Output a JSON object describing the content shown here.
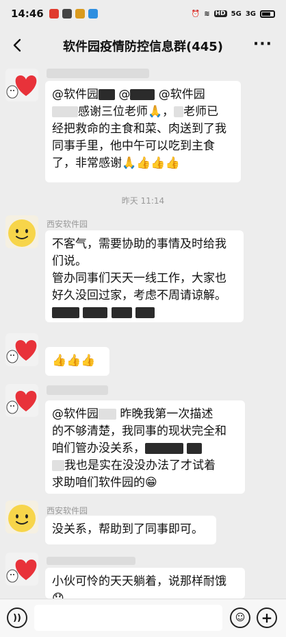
{
  "status_bar": {
    "time": "14:46",
    "network_labels": [
      "HD",
      "5G",
      "3G"
    ]
  },
  "header": {
    "title": "软件园疫情防控信息群(445)",
    "more": "···"
  },
  "messages": [
    {
      "sender": "",
      "avatar": "heart-cat",
      "lines": [
        "@软件园▮ @▮ @软件园▮",
        "▮感谢三位老师🙏，▮老师已",
        "经把救命的主食和菜、肉送到了我",
        "同事手里，他中午可以吃到主食",
        "了，非常感谢🙏👍👍👍"
      ]
    },
    {
      "sender": "西安软件园",
      "avatar": "smile",
      "lines": [
        "不客气，需要协助的事情及时给我",
        "们说。",
        "管办同事们天天一线工作，大家也",
        "好久没回过家，考虑不周请谅解。"
      ]
    },
    {
      "sender": "",
      "avatar": "heart-cat",
      "lines": [
        "👍👍👍"
      ]
    },
    {
      "sender": "",
      "avatar": "heart-cat",
      "lines": [
        "@软件园▮ 昨晚我第一次描述",
        "的不够清楚，我同事的现状完全和",
        "咱们管办没关系，▮",
        "▮我也是实在没没办法了才试着",
        "求助咱们软件园的😁"
      ]
    },
    {
      "sender": "西安软件园",
      "avatar": "smile",
      "lines": [
        "没关系，帮助到了同事即可。"
      ]
    },
    {
      "sender": "",
      "avatar": "heart-cat",
      "lines": [
        "小伙可怜的天天躺着，说那样耐饿",
        "😞"
      ]
    }
  ],
  "time_separator": "昨天 11:14",
  "input_bar": {
    "voice_label": "))",
    "placeholder": "",
    "emoji_label": "☺",
    "plus_label": "+"
  }
}
